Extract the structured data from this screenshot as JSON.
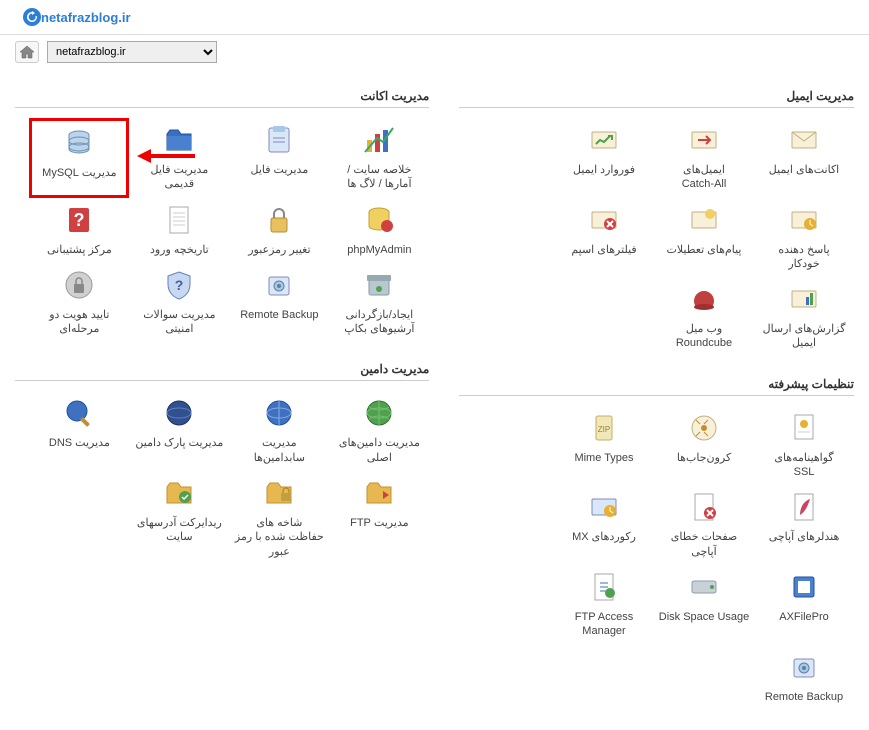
{
  "header": {
    "title": "netafrazblog.ir"
  },
  "navbar": {
    "domain_value": "netafrazblog.ir"
  },
  "sections": {
    "account": {
      "title": "مدیریت اکانت",
      "items": [
        {
          "id": "site-summary",
          "label": "خلاصه سایت /\nآمارها / لاگ ها",
          "icon": "chart"
        },
        {
          "id": "file-manager",
          "label": "مدیریت فایل",
          "icon": "files"
        },
        {
          "id": "old-file-manager",
          "label": "مدیریت فایل\nقدیمی",
          "icon": "folder-blue"
        },
        {
          "id": "mysql",
          "label": "مدیریت MySQL",
          "icon": "database",
          "highlight": true,
          "arrow": true
        },
        {
          "id": "phpmyadmin",
          "label": "phpMyAdmin",
          "icon": "db-yellow"
        },
        {
          "id": "change-password",
          "label": "تغییر رمزعبور",
          "icon": "lock"
        },
        {
          "id": "login-history",
          "label": "تاریخچه ورود",
          "icon": "document"
        },
        {
          "id": "support-center",
          "label": "مرکز پشتیبانی",
          "icon": "question-red"
        },
        {
          "id": "backup",
          "label": "ایجاد/بازگردانی\nآرشیوهای بکاپ",
          "icon": "archive"
        },
        {
          "id": "remote-backup1",
          "label": "Remote Backup",
          "icon": "safe"
        },
        {
          "id": "security-questions",
          "label": "مدیریت سوالات\nامنیتی",
          "icon": "shield-q"
        },
        {
          "id": "two-factor",
          "label": "تایید هویت دو\nمرحله‌ای",
          "icon": "lock-grey"
        }
      ]
    },
    "domain": {
      "title": "مدیریت دامین",
      "items": [
        {
          "id": "main-domains",
          "label": "مدیریت دامین‌های\nاصلی",
          "icon": "globe-green"
        },
        {
          "id": "subdomains",
          "label": "مدیریت\nسابدامین‌ها",
          "icon": "globe-blue"
        },
        {
          "id": "park-domain",
          "label": "مدیریت پارک دامین",
          "icon": "globe-dark"
        },
        {
          "id": "dns",
          "label": "مدیریت DNS",
          "icon": "globe-tool"
        },
        {
          "id": "ftp",
          "label": "مدیریت FTP",
          "icon": "folder-arrow"
        },
        {
          "id": "protected-branches",
          "label": "شاخه های\nحفاظت شده با رمز\nعبور",
          "icon": "folder-lock"
        },
        {
          "id": "site-redirects",
          "label": "ریدایرکت آدرسهای\nسایت",
          "icon": "folder-green"
        }
      ]
    },
    "email": {
      "title": "مدیریت ایمیل",
      "items": [
        {
          "id": "email-accounts",
          "label": "اکانت‌های ایمیل",
          "icon": "mail"
        },
        {
          "id": "catchall",
          "label": "ایمیل‌های\nCatch-All",
          "icon": "mail-arrow"
        },
        {
          "id": "forward",
          "label": "فوروارد ایمیل",
          "icon": "mail-fwd"
        },
        {
          "id": "autoresponder",
          "label": "پاسخ دهنده\nخودکار",
          "icon": "mail-auto"
        },
        {
          "id": "vacation",
          "label": "پیام‌های تعطیلات",
          "icon": "mail-vac"
        },
        {
          "id": "spam-filters",
          "label": "فیلترهای اسپم",
          "icon": "mail-spam"
        },
        {
          "id": "email-reports",
          "label": "گزارش‌های ارسال\nایمیل",
          "icon": "mail-report"
        },
        {
          "id": "roundcube",
          "label": "وب میل\nRoundcube",
          "icon": "roundcube"
        }
      ]
    },
    "advanced": {
      "title": "تنظیمات پیشرفته",
      "items": [
        {
          "id": "ssl",
          "label": "گواهینامه‌های\nSSL",
          "icon": "cert"
        },
        {
          "id": "cronjobs",
          "label": "کرون‌جاب‌ها",
          "icon": "cron"
        },
        {
          "id": "mime",
          "label": "Mime Types",
          "icon": "zip"
        },
        {
          "id": "apache-handlers",
          "label": "هندلرهای آپاچی",
          "icon": "feather"
        },
        {
          "id": "error-pages",
          "label": "صفحات خطای\nآپاچی",
          "icon": "error-page"
        },
        {
          "id": "mx-records",
          "label": "رکوردهای MX",
          "icon": "mx"
        },
        {
          "id": "axfilepro",
          "label": "AXFilePro",
          "icon": "ax"
        },
        {
          "id": "disk-usage",
          "label": "Disk Space Usage",
          "icon": "disk"
        },
        {
          "id": "ftp-access",
          "label": "FTP Access\nManager",
          "icon": "ftp-access"
        },
        {
          "id": "remote-backup2",
          "label": "Remote Backup",
          "icon": "safe"
        }
      ]
    }
  }
}
